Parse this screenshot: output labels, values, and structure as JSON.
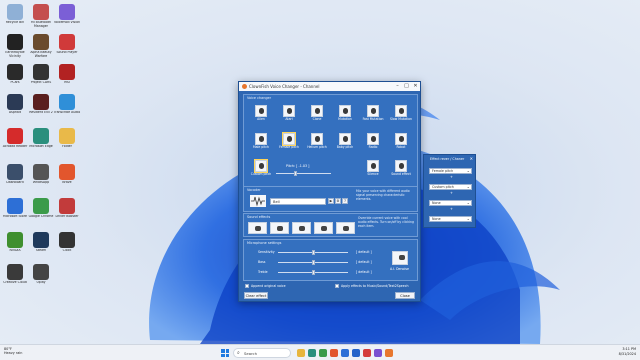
{
  "desktop": {
    "icons": [
      {
        "label": "Recycle Bin",
        "color": "#8fb0d6",
        "icon": "recycle-bin-icon"
      },
      {
        "label": "Mi Bluetooth Manager",
        "color": "#c44f4f",
        "icon": "app-icon"
      },
      {
        "label": "Voicemod Vision",
        "color": "#7b5fd6",
        "icon": "app-icon"
      },
      {
        "label": "EarthRoyale Vicinity",
        "color": "#222222",
        "icon": "app-icon"
      },
      {
        "label": "Alpha Beauty Warfare",
        "color": "#6a4b2d",
        "icon": "app-icon"
      },
      {
        "label": "Sound Player",
        "color": "#d03a3a",
        "icon": "app-icon"
      },
      {
        "label": "PCars",
        "color": "#2a2a2a",
        "icon": "app-icon"
      },
      {
        "label": "Project CARS",
        "color": "#333333",
        "icon": "app-icon"
      },
      {
        "label": "MSI",
        "color": "#b22222",
        "icon": "app-icon"
      },
      {
        "label": "Asphalt",
        "color": "#2b3a55",
        "icon": "app-icon"
      },
      {
        "label": "Resident Evil 2",
        "color": "#5a1f1f",
        "icon": "app-icon"
      },
      {
        "label": "Transcribe Audio",
        "color": "#2f8fd8",
        "icon": "app-icon"
      },
      {
        "label": "Acrobat Reader",
        "color": "#d52b2b",
        "icon": "pdf-icon"
      },
      {
        "label": "Microsoft Edge",
        "color": "#2a8f7d",
        "icon": "edge-icon"
      },
      {
        "label": "Folder",
        "color": "#e9b949",
        "icon": "folder-icon"
      },
      {
        "label": "Dashboard",
        "color": "#3b4f6b",
        "icon": "app-icon"
      },
      {
        "label": "WhatsApp",
        "color": "#555555",
        "icon": "app-icon"
      },
      {
        "label": "Brave",
        "color": "#e2562d",
        "icon": "brave-icon"
      },
      {
        "label": "Microsoft Store",
        "color": "#2d6fd6",
        "icon": "store-icon"
      },
      {
        "label": "Google Chrome",
        "color": "#3b9b4a",
        "icon": "chrome-icon"
      },
      {
        "label": "Driver Booster",
        "color": "#c23b3b",
        "icon": "app-icon"
      },
      {
        "label": "NVIDIA",
        "color": "#3f8f2f",
        "icon": "app-icon"
      },
      {
        "label": "Steam",
        "color": "#1f3a5c",
        "icon": "steam-icon"
      },
      {
        "label": "Clock",
        "color": "#333333",
        "icon": "app-icon"
      },
      {
        "label": "Creative Cloud",
        "color": "#3a3a3a",
        "icon": "app-icon"
      },
      {
        "label": "Uplay",
        "color": "#444444",
        "icon": "app-icon"
      }
    ]
  },
  "window": {
    "title": "ClownFish Voice Changer - Channel",
    "minimize": "–",
    "maximize": "□",
    "close": "✕",
    "voice_section_title": "Voice changer",
    "voices": [
      {
        "label": "Alien"
      },
      {
        "label": "Atari"
      },
      {
        "label": "Clone"
      },
      {
        "label": "Mutation"
      },
      {
        "label": "Fast Mutation"
      },
      {
        "label": "Slow Mutation"
      },
      {
        "label": "Male pitch"
      },
      {
        "label": "Female pitch"
      },
      {
        "label": "Helium pitch"
      },
      {
        "label": "Baby pitch"
      },
      {
        "label": "Radio"
      },
      {
        "label": "Robot"
      },
      {
        "label": "Custom pitch"
      },
      {
        "label": "Silence"
      },
      {
        "label": "Sound effect"
      }
    ],
    "pitch_label": "Pitch: [ -1.03 ]",
    "pitch_fraction": 0.35,
    "vocoder_title": "Vocoder",
    "vocoder_value": "Bell",
    "vocoder_desc": "Mix your voice with different audio signal preserving characteristic elements.",
    "sound_effects_title": "Sound effects",
    "sound_effects_desc": "Override current voice with cool audio effects. Turn on/off by clicking each item.",
    "mic_title": "Microphone settings",
    "mic_rows": [
      {
        "label": "Sensitivity",
        "value": "[ default ]",
        "fraction": 0.5
      },
      {
        "label": "Bass",
        "value": "[ default ]",
        "fraction": 0.5
      },
      {
        "label": "Treble",
        "value": "[ default ]",
        "fraction": 0.5
      }
    ],
    "denoise_label": "A.I. Denoise",
    "append_label": "Append original voice",
    "apply_label": "Apply effects to Music/Sound/Text2Speech",
    "clear_button": "Clear effect",
    "close_button": "Close"
  },
  "effect_panel": {
    "title": "Effect rever / Chaner",
    "close": "✕",
    "selects": [
      "Female pitch",
      "Custom pitch",
      "None",
      "None"
    ],
    "arrow": "+"
  },
  "taskbar": {
    "weather_temp": "80°F",
    "weather_text": "Heavy rain",
    "search": "Search",
    "time": "3:11 PM",
    "date": "8/31/2024",
    "apps": [
      {
        "icon": "explorer-icon",
        "color": "#e7b53c"
      },
      {
        "icon": "edge-icon",
        "color": "#2a8f7d"
      },
      {
        "icon": "chrome-icon",
        "color": "#3b9b4a"
      },
      {
        "icon": "brave-icon",
        "color": "#e2562d"
      },
      {
        "icon": "store-icon",
        "color": "#2d6fd6"
      },
      {
        "icon": "mail-icon",
        "color": "#2563c9"
      },
      {
        "icon": "app-icon",
        "color": "#d43c3c"
      },
      {
        "icon": "app-icon",
        "color": "#7a4fd0"
      },
      {
        "icon": "app-icon",
        "color": "#e8772e"
      }
    ]
  }
}
